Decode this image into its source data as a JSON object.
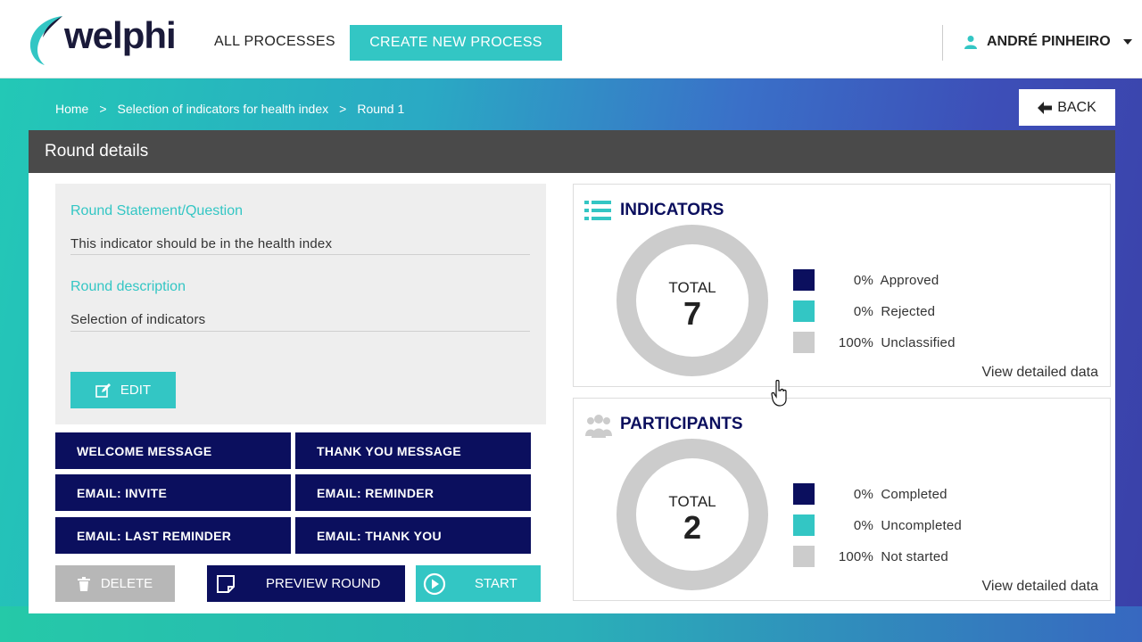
{
  "colors": {
    "teal": "#33c6c4",
    "navy": "#0b0f5e",
    "grey": "#cccccc",
    "header_dark": "#4a4a4a"
  },
  "header": {
    "logo_text": "welphi",
    "nav_all": "ALL PROCESSES",
    "create_label": "CREATE NEW PROCESS",
    "user_name": "ANDRÉ PINHEIRO"
  },
  "breadcrumb": {
    "home": "Home",
    "process": "Selection of indicators for health index",
    "round": "Round 1",
    "sep": ">"
  },
  "back_label": "BACK",
  "panel": {
    "title": "Round details",
    "statement_label": "Round Statement/Question",
    "statement_value": "This indicator should be in the health index",
    "description_label": "Round description",
    "description_value": "Selection of indicators",
    "edit_label": "EDIT"
  },
  "message_buttons": [
    "WELCOME MESSAGE",
    "THANK YOU MESSAGE",
    "EMAIL: INVITE",
    "EMAIL: REMINDER",
    "EMAIL: LAST REMINDER",
    "EMAIL: THANK YOU"
  ],
  "actions": {
    "delete_label": "DELETE",
    "preview_label": "PREVIEW ROUND",
    "start_label": "START"
  },
  "indicators": {
    "title": "INDICATORS",
    "total_label": "TOTAL",
    "total": "7",
    "legend": [
      {
        "pct": "0%",
        "label": "Approved",
        "color": "#0b0f5e"
      },
      {
        "pct": "0%",
        "label": "Rejected",
        "color": "#33c6c4"
      },
      {
        "pct": "100%",
        "label": "Unclassified",
        "color": "#cccccc"
      }
    ],
    "view_link": "View detailed data"
  },
  "participants": {
    "title": "PARTICIPANTS",
    "total_label": "TOTAL",
    "total": "2",
    "legend": [
      {
        "pct": "0%",
        "label": "Completed",
        "color": "#0b0f5e"
      },
      {
        "pct": "0%",
        "label": "Uncompleted",
        "color": "#33c6c4"
      },
      {
        "pct": "100%",
        "label": "Not started",
        "color": "#cccccc"
      }
    ],
    "view_link": "View detailed data"
  }
}
